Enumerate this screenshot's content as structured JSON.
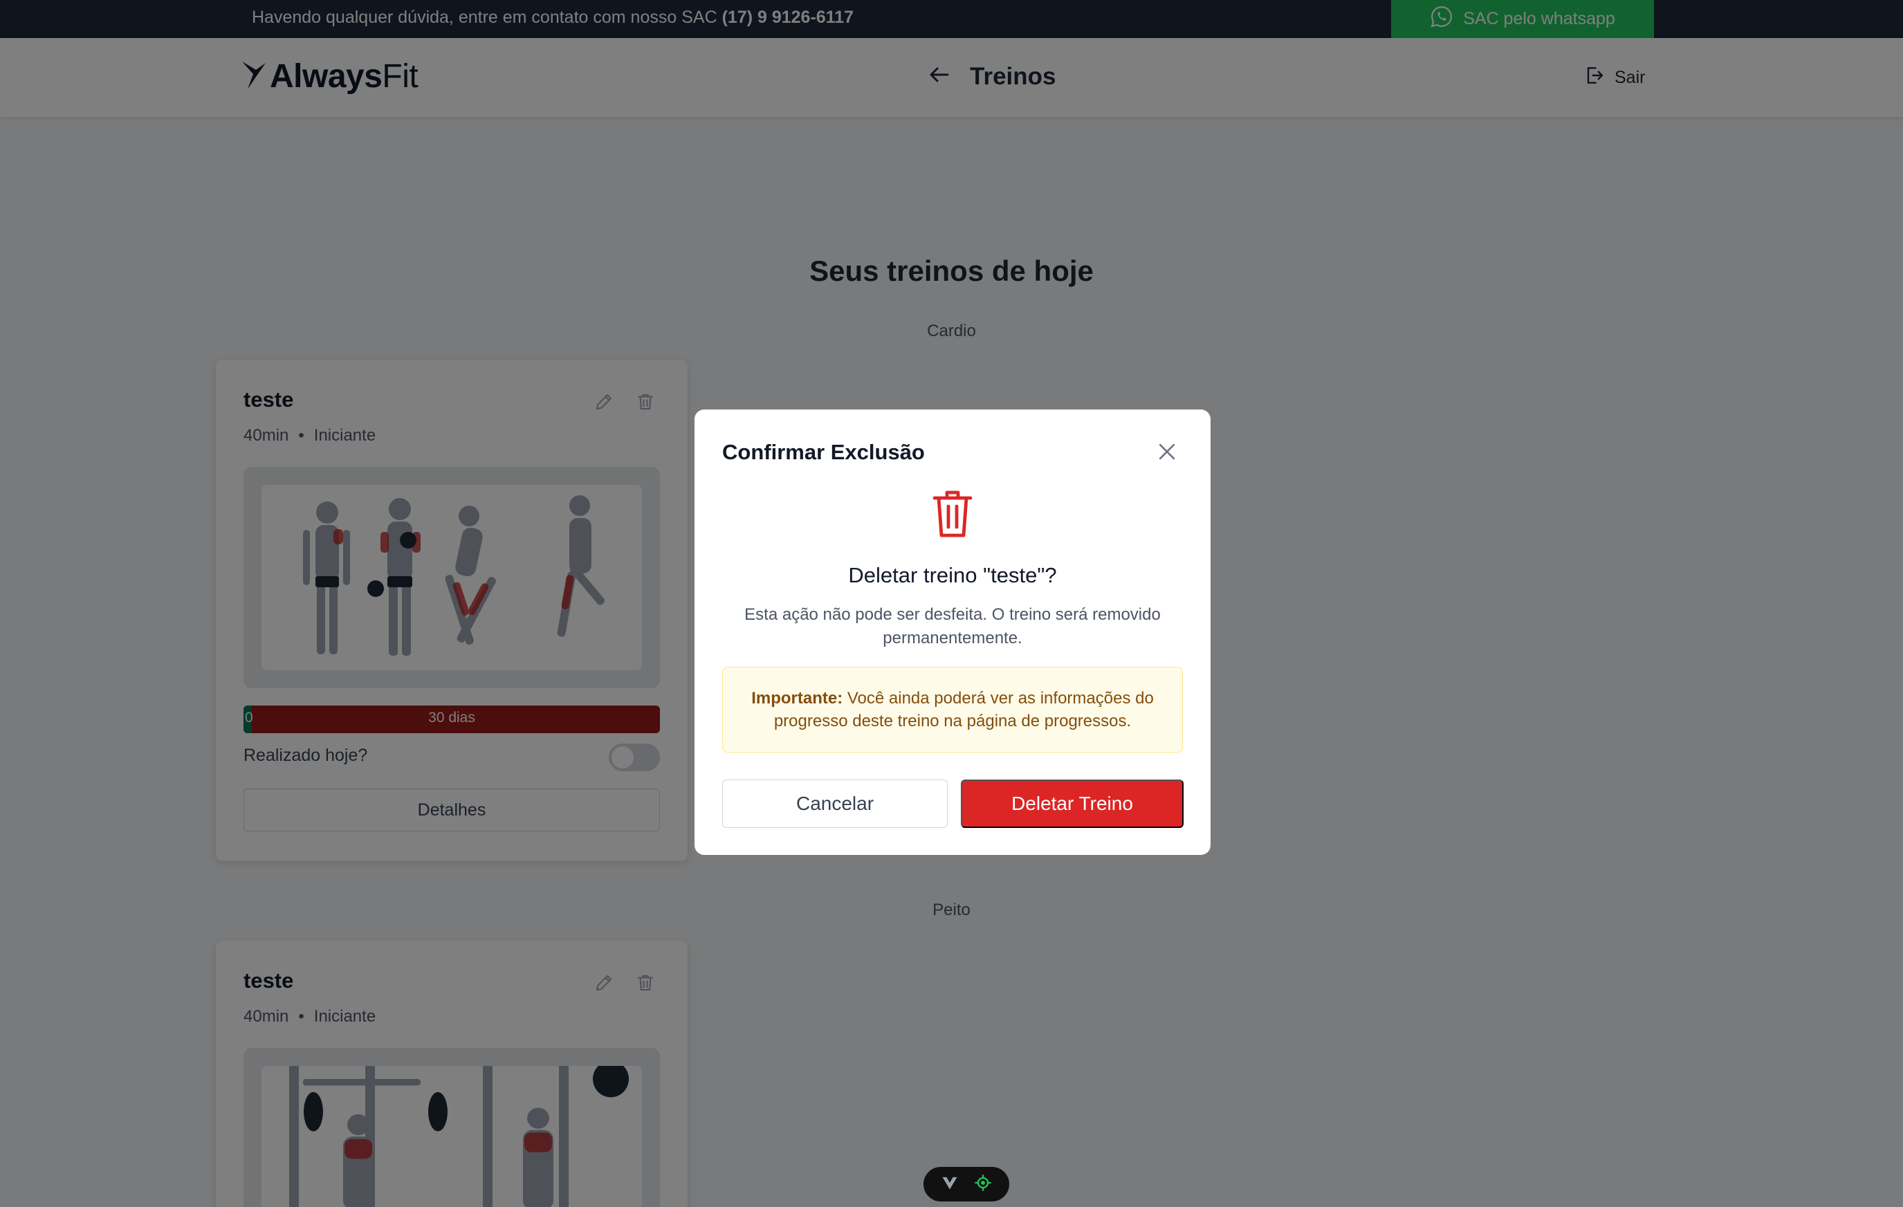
{
  "topbar": {
    "text": "Havendo qualquer dúvida, entre em contato com nosso SAC",
    "phone": "(17) 9 9126-6117",
    "whatsapp_label": "SAC pelo whatsapp",
    "whatsapp_icon": "whatsapp-icon"
  },
  "header": {
    "logo_bold": "Always",
    "logo_light": "Fit",
    "title": "Treinos",
    "back_icon": "arrow-left-icon",
    "logout_label": "Sair",
    "logout_icon": "logout-icon"
  },
  "main": {
    "page_title": "Seus treinos de hoje",
    "sections": [
      {
        "label": "Cardio",
        "card": {
          "title": "teste",
          "duration": "40min",
          "separator": "•",
          "level": "Iniciante",
          "progress_start": "0",
          "progress_label": "30 dias",
          "progress_fraction": 0.02,
          "done_label": "Realizado hoje?",
          "done_checked": false,
          "details_label": "Detalhes"
        }
      },
      {
        "label": "Peito",
        "card": {
          "title": "teste",
          "duration": "40min",
          "separator": "•",
          "level": "Iniciante"
        }
      }
    ]
  },
  "modal": {
    "title": "Confirmar Exclusão",
    "question": "Deletar treino \"teste\"?",
    "description": "Esta ação não pode ser desfeita. O treino será removido permanentemente.",
    "note_strong": "Importante:",
    "note_text": "Você ainda poderá ver as informações do progresso deste treino na página de progressos.",
    "cancel_label": "Cancelar",
    "delete_label": "Deletar Treino"
  },
  "colors": {
    "topbar": "#1e293b",
    "whatsapp": "#22c55e",
    "danger": "#dc2626",
    "progress_bg": "#991b1b",
    "progress_fill": "#047857",
    "note_bg": "#fefce8",
    "note_text": "#854d0e"
  }
}
